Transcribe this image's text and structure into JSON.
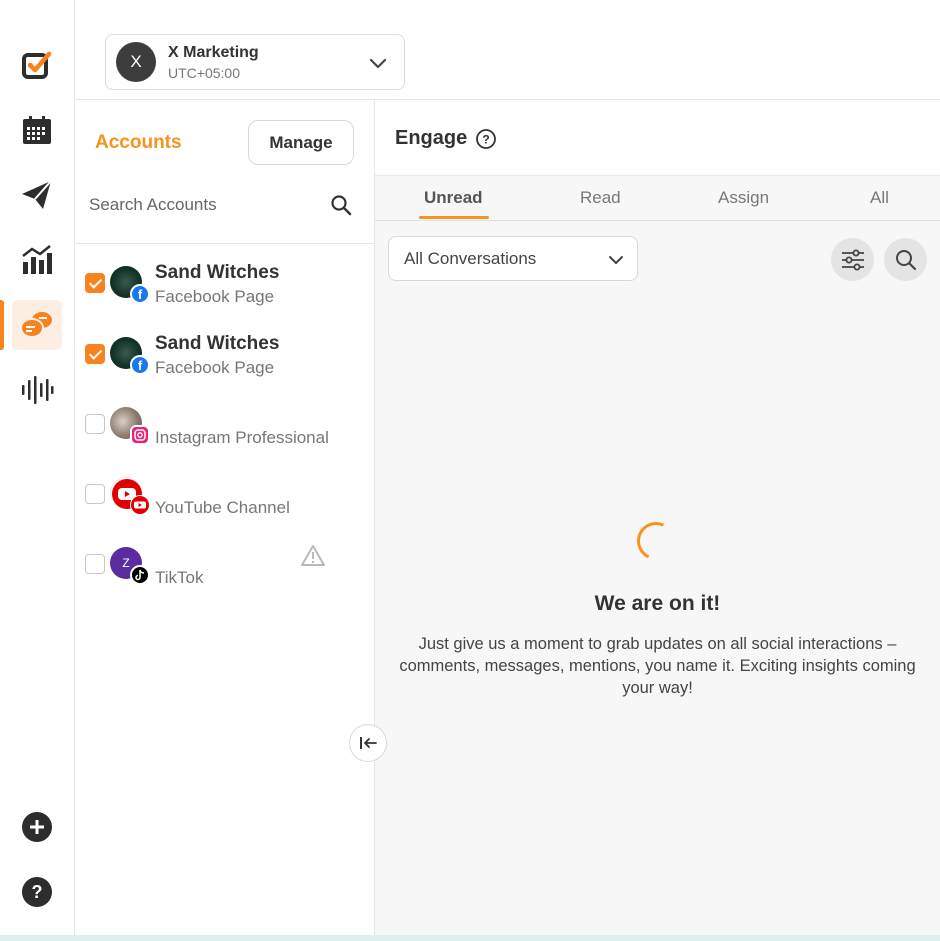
{
  "rail": {
    "icons": [
      "brand-logo-icon",
      "calendar-icon",
      "publish-send-icon",
      "analytics-icon",
      "engage-chat-icon",
      "listening-waveform-icon",
      "add-icon",
      "help-icon"
    ],
    "active": "engage-chat-icon",
    "accent": "#f7821f"
  },
  "workspace": {
    "avatar_letter": "X",
    "name": "X Marketing",
    "timezone": "UTC+05:00"
  },
  "accounts": {
    "title": "Accounts",
    "manage_label": "Manage",
    "search_placeholder": "Search Accounts",
    "items": [
      {
        "name": "Sand Witches",
        "type": "Facebook Page",
        "checked": true,
        "network": "facebook"
      },
      {
        "name": "Sand Witches",
        "type": "Facebook Page",
        "checked": true,
        "network": "facebook"
      },
      {
        "name": "",
        "type": "Instagram Professional",
        "checked": false,
        "network": "instagram"
      },
      {
        "name": "",
        "type": "YouTube Channel",
        "checked": false,
        "network": "youtube"
      },
      {
        "name": "",
        "type": "TikTok",
        "checked": false,
        "network": "tiktok",
        "avatar_letter": "Z",
        "warning": true
      }
    ]
  },
  "engage": {
    "title": "Engage",
    "tabs": [
      "Unread",
      "Read",
      "Assign",
      "All"
    ],
    "active_tab": "Unread",
    "filter_value": "All Conversations",
    "loading_title": "We are on it!",
    "loading_text": "Just give us a moment to grab updates on all social interactions – comments, messages, mentions, you name it. Exciting insights coming your way!"
  },
  "colors": {
    "accent": "#f7941d",
    "facebook": "#1877f2",
    "instagram": "#e6247a",
    "youtube": "#e00000",
    "tiktok": "#000000"
  }
}
